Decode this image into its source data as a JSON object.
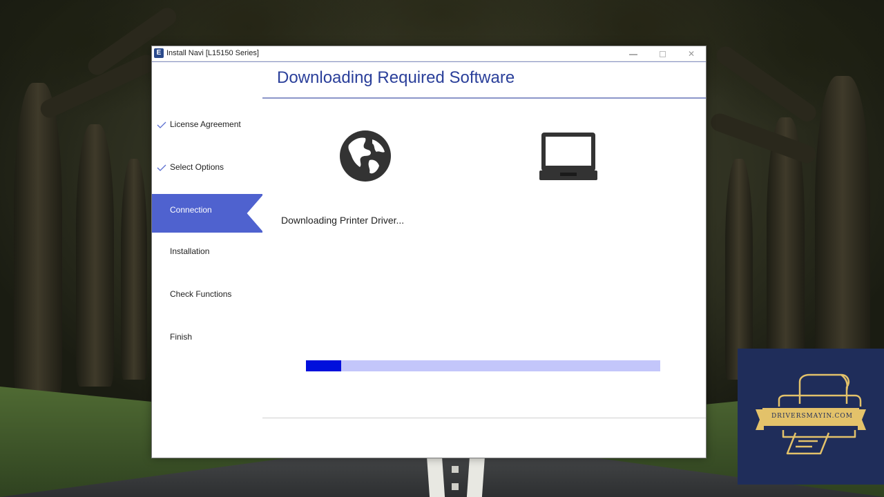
{
  "window": {
    "title": "Install Navi [L15150 Series]",
    "app_icon_letter": "E",
    "minimize_glyph": "—",
    "close_glyph": "✕"
  },
  "header": {
    "title": "Downloading Required Software"
  },
  "sidebar": {
    "steps": [
      {
        "label": "License Agreement",
        "state": "completed"
      },
      {
        "label": "Select Options",
        "state": "completed"
      },
      {
        "label": "Connection",
        "state": "active"
      },
      {
        "label": "Installation",
        "state": "pending"
      },
      {
        "label": "Check Functions",
        "state": "pending"
      },
      {
        "label": "Finish",
        "state": "pending"
      }
    ]
  },
  "main": {
    "source_icon": "globe-icon",
    "target_icon": "laptop-icon",
    "status_text": "Downloading Printer Driver...",
    "progress_fraction": 0.1
  },
  "colors": {
    "accent": "#4f62cf",
    "header_text": "#2a3f9a",
    "progress_fill": "#0010dc",
    "progress_track": "#c3c6fa",
    "badge_bg": "#1f2d5a",
    "badge_gold": "#e3c26a"
  },
  "watermark": {
    "text": "DRIVERSMAYIN.COM"
  }
}
